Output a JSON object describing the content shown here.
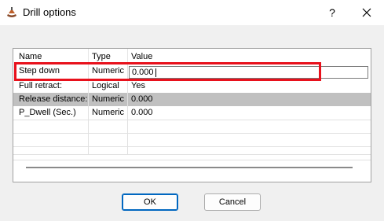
{
  "window": {
    "title": "Drill options",
    "help_label": "?",
    "close_label": "×"
  },
  "table": {
    "columns": [
      "Name",
      "Type",
      "Value"
    ],
    "rows": [
      {
        "name": "Step down",
        "type": "Numeric",
        "value": "0.000",
        "editing": true
      },
      {
        "name": "Full retract:",
        "type": "Logical",
        "value": "Yes"
      },
      {
        "name": "Release distance:",
        "type": "Numeric",
        "value": "0.000",
        "selected": true
      },
      {
        "name": "P_Dwell (Sec.)",
        "type": "Numeric",
        "value": "0.000"
      }
    ]
  },
  "buttons": {
    "ok": "OK",
    "cancel": "Cancel"
  },
  "colors": {
    "highlight_border": "#e8111c",
    "selected_row": "#c0c0c0",
    "ok_border": "#0067c0"
  }
}
